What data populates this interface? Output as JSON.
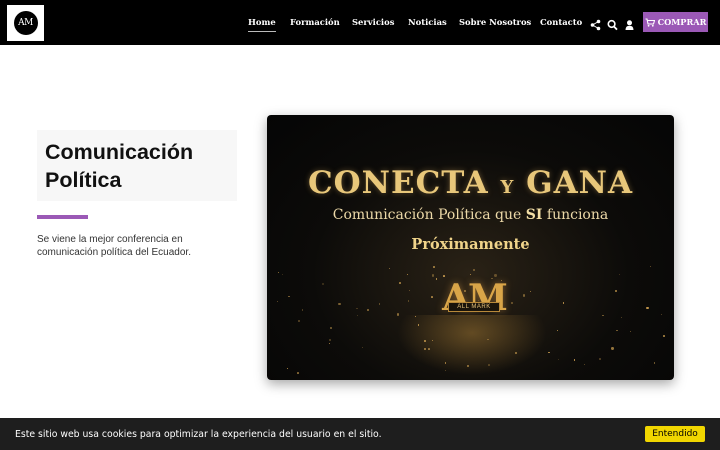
{
  "header": {
    "logo_text": "AM",
    "nav": [
      {
        "label": "Home",
        "active": true
      },
      {
        "label": "Formación",
        "active": false
      },
      {
        "label": "Servicios",
        "active": false
      },
      {
        "label": "Noticias",
        "active": false
      },
      {
        "label": "Sobre Nosotros",
        "active": false
      },
      {
        "label": "Contacto",
        "active": false
      }
    ],
    "icons": [
      "share-icon",
      "search-icon",
      "user-icon",
      "cart-icon"
    ],
    "buy_label": "COMPRAR"
  },
  "main": {
    "title": "Comunicación Política",
    "description": "Se viene la mejor conferencia en comunicación política del Ecuador.",
    "banner": {
      "title_part1": "CONECTA",
      "title_connector": "Y",
      "title_part2": "GANA",
      "subtitle_before": "Comunicación Política que ",
      "subtitle_bold": "SI",
      "subtitle_after": " funciona",
      "soon": "Próximamente",
      "logo_letters": "AM",
      "logo_brand": "ALL MARK"
    }
  },
  "cookie": {
    "text": "Este sitio web usa cookies para optimizar la experiencia del usuario en el sitio.",
    "button_label": "Entendido"
  },
  "colors": {
    "accent": "#9b59b6",
    "header_bg": "#000000",
    "cookie_button": "#f1d600",
    "banner_gold": "#e8c77a"
  }
}
